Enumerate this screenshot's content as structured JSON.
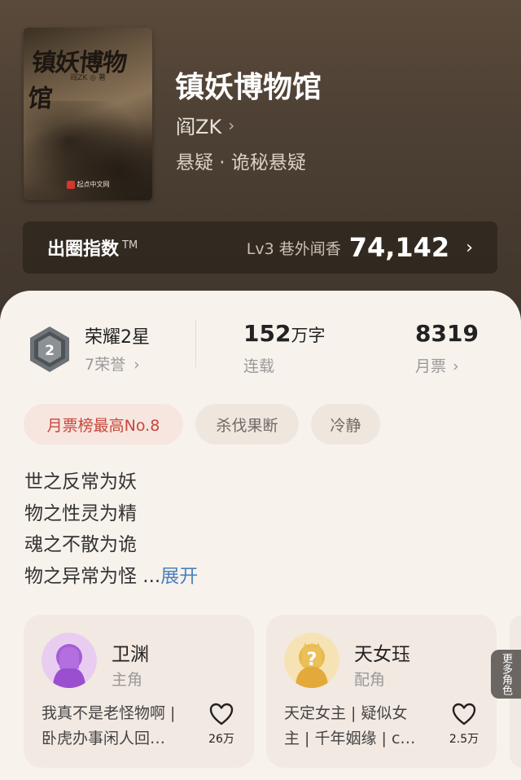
{
  "book": {
    "title": "镇妖博物馆",
    "author": "阎ZK",
    "genre": "悬疑 · 诡秘悬疑",
    "cover": {
      "title": "镇妖博物馆",
      "author_line": "阎ZK ◎ 著",
      "publisher": "起点中文网"
    }
  },
  "index_bar": {
    "label": "出圈指数",
    "tm": "TM",
    "level": "Lv3 巷外闻香",
    "score": "74,142"
  },
  "stats": {
    "honor_title": "荣耀2星",
    "honor_sub": "7荣誉",
    "words_num": "152",
    "words_unit": "万字",
    "words_label": "连载",
    "votes_num": "8319",
    "votes_label": "月票"
  },
  "tags": [
    "月票榜最高No.8",
    "杀伐果断",
    "冷静"
  ],
  "synopsis": {
    "lines": [
      "世之反常为妖",
      "物之性灵为精",
      "魂之不散为诡",
      "物之异常为怪 ..."
    ],
    "expand_label": "展开"
  },
  "characters": [
    {
      "name": "卫渊",
      "role": "主角",
      "desc_lines": [
        "我真不是老怪物啊 |",
        "卧虎办事闲人回…"
      ],
      "likes": "26万"
    },
    {
      "name": "天女珏",
      "role": "配角",
      "desc_lines": [
        "天定女主 | 疑似女",
        "主 | 千年姻缘 | c…"
      ],
      "likes": "2.5万"
    }
  ],
  "more_roles_label": "更多角色",
  "colors": {
    "accent_red": "#c8473c",
    "link_blue": "#4a7fc1",
    "hero_bg": "#4c3f33"
  }
}
